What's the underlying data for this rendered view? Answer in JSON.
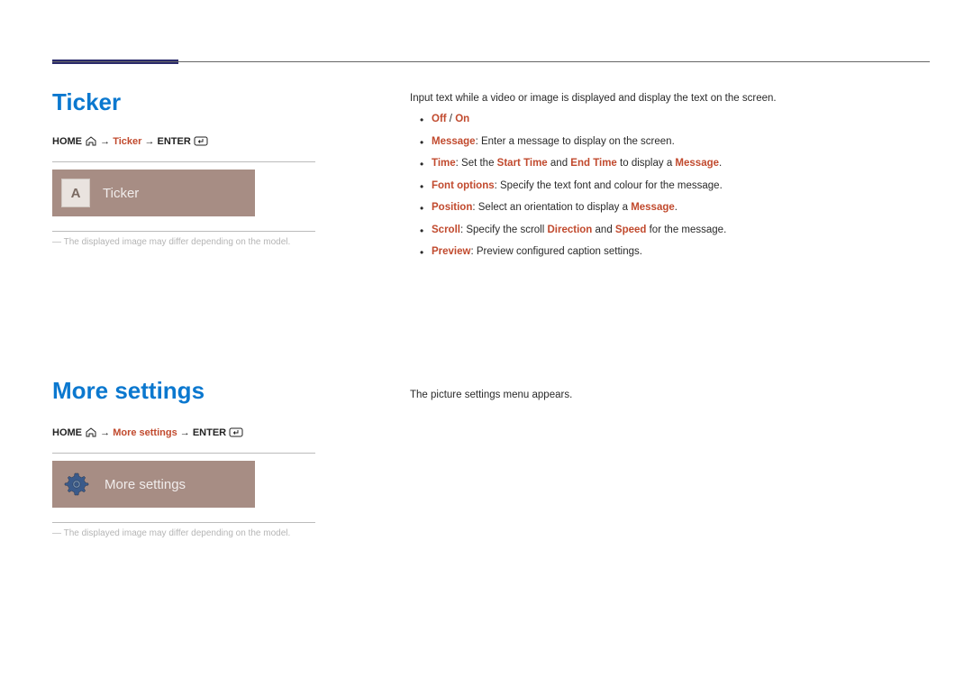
{
  "section1": {
    "title": "Ticker",
    "breadcrumb": {
      "home": "HOME",
      "path": "Ticker",
      "enter": "ENTER"
    },
    "tile": {
      "iconLetter": "A",
      "label": "Ticker"
    },
    "disclaimer": "The displayed image may differ depending on the model.",
    "intro": "Input text while a video or image is displayed and display the text on the screen.",
    "bullets": {
      "b1": {
        "hl1": "Off",
        "sep": " / ",
        "hl2": "On"
      },
      "b2": {
        "key": "Message",
        "text": ": Enter a message to display on the screen."
      },
      "b3": {
        "key": "Time",
        "p1": ": Set the ",
        "hl1": "Start Time",
        "p2": " and ",
        "hl2": "End Time",
        "p3": " to display a ",
        "hl3": "Message",
        "p4": "."
      },
      "b4": {
        "key": "Font options",
        "text": ": Specify the text font and colour for the message."
      },
      "b5": {
        "key": "Position",
        "p1": ": Select an orientation to display a ",
        "hl1": "Message",
        "p2": "."
      },
      "b6": {
        "key": "Scroll",
        "p1": ": Specify the scroll ",
        "hl1": "Direction",
        "p2": " and ",
        "hl2": "Speed",
        "p3": " for the message."
      },
      "b7": {
        "key": "Preview",
        "text": ": Preview configured caption settings."
      }
    }
  },
  "section2": {
    "title": "More settings",
    "breadcrumb": {
      "home": "HOME",
      "path": "More settings",
      "enter": "ENTER"
    },
    "tile": {
      "label": "More settings"
    },
    "disclaimer": "The displayed image may differ depending on the model.",
    "intro": "The picture settings menu appears."
  }
}
